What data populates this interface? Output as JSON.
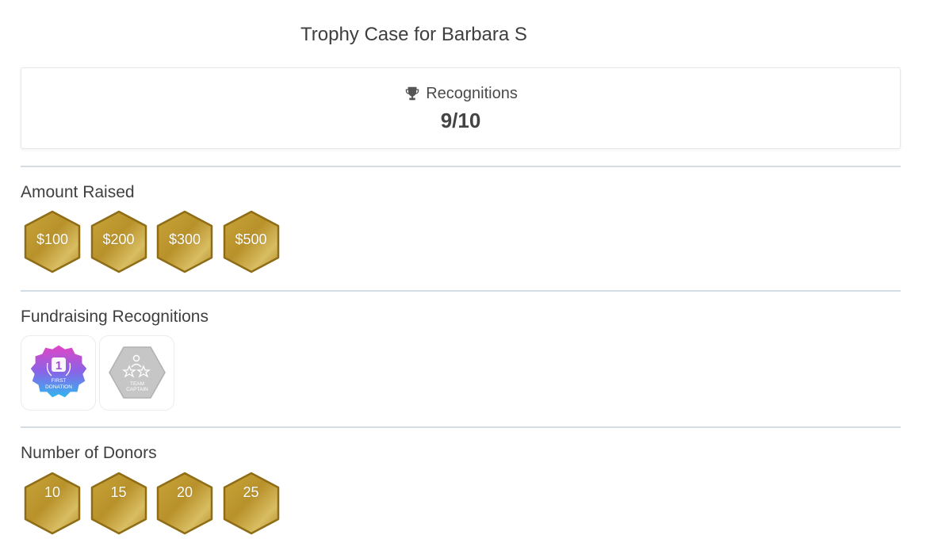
{
  "page": {
    "title": "Trophy Case for Barbara S"
  },
  "summary": {
    "icon": "trophy-icon",
    "label": "Recognitions",
    "count": "9/10"
  },
  "colors": {
    "gold_dark": "#9c7a1d",
    "gold_light": "#dcc05c",
    "gray_badge": "#c4c4c4"
  },
  "sections": {
    "amount_raised": {
      "title": "Amount Raised",
      "badges": [
        {
          "label": "$100"
        },
        {
          "label": "$200"
        },
        {
          "label": "$300"
        },
        {
          "label": "$500"
        }
      ]
    },
    "fundraising": {
      "title": "Fundraising Recognitions",
      "badges": [
        {
          "name": "first-donation-badge",
          "number": "1",
          "line1": "FIRST",
          "line2": "DONATION",
          "earned": true
        },
        {
          "name": "team-captain-badge",
          "line1": "TEAM",
          "line2": "CAPTAIN",
          "earned": false
        }
      ]
    },
    "donors": {
      "title": "Number of Donors",
      "badges": [
        {
          "label": "10",
          "icon": "heart-icon"
        },
        {
          "label": "15",
          "icon": "heart-icon"
        },
        {
          "label": "20",
          "icon": "heart-icon"
        },
        {
          "label": "25",
          "icon": "heart-icon"
        }
      ]
    }
  }
}
